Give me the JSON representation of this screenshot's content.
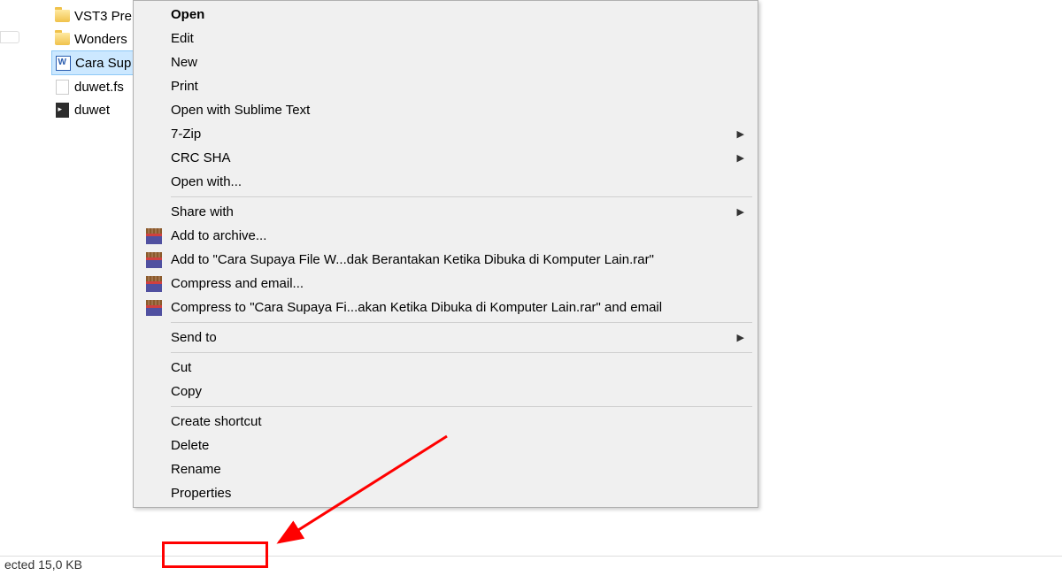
{
  "files": [
    {
      "name": "VST3 Pre",
      "type": "folder"
    },
    {
      "name": "Wonders",
      "type": "folder"
    },
    {
      "name": "Cara Sup",
      "type": "word",
      "selected": true
    },
    {
      "name": "duwet.fs",
      "type": "blank"
    },
    {
      "name": "duwet",
      "type": "dark"
    }
  ],
  "menu": {
    "open": "Open",
    "edit": "Edit",
    "new": "New",
    "print": "Print",
    "openSublime": "Open with Sublime Text",
    "sevenzip": "7-Zip",
    "crcsha": "CRC SHA",
    "openwith": "Open with...",
    "sharewith": "Share with",
    "addArchive": "Add to archive...",
    "addTo": "Add to \"Cara Supaya File W...dak Berantakan Ketika Dibuka di Komputer Lain.rar\"",
    "compressEmail": "Compress and email...",
    "compressTo": "Compress to \"Cara Supaya Fi...akan Ketika Dibuka di Komputer Lain.rar\" and email",
    "sendto": "Send to",
    "cut": "Cut",
    "copy": "Copy",
    "createShortcut": "Create shortcut",
    "delete": "Delete",
    "rename": "Rename",
    "properties": "Properties"
  },
  "status": "ected   15,0 KB",
  "annotation": {
    "highlightTarget": "properties"
  }
}
